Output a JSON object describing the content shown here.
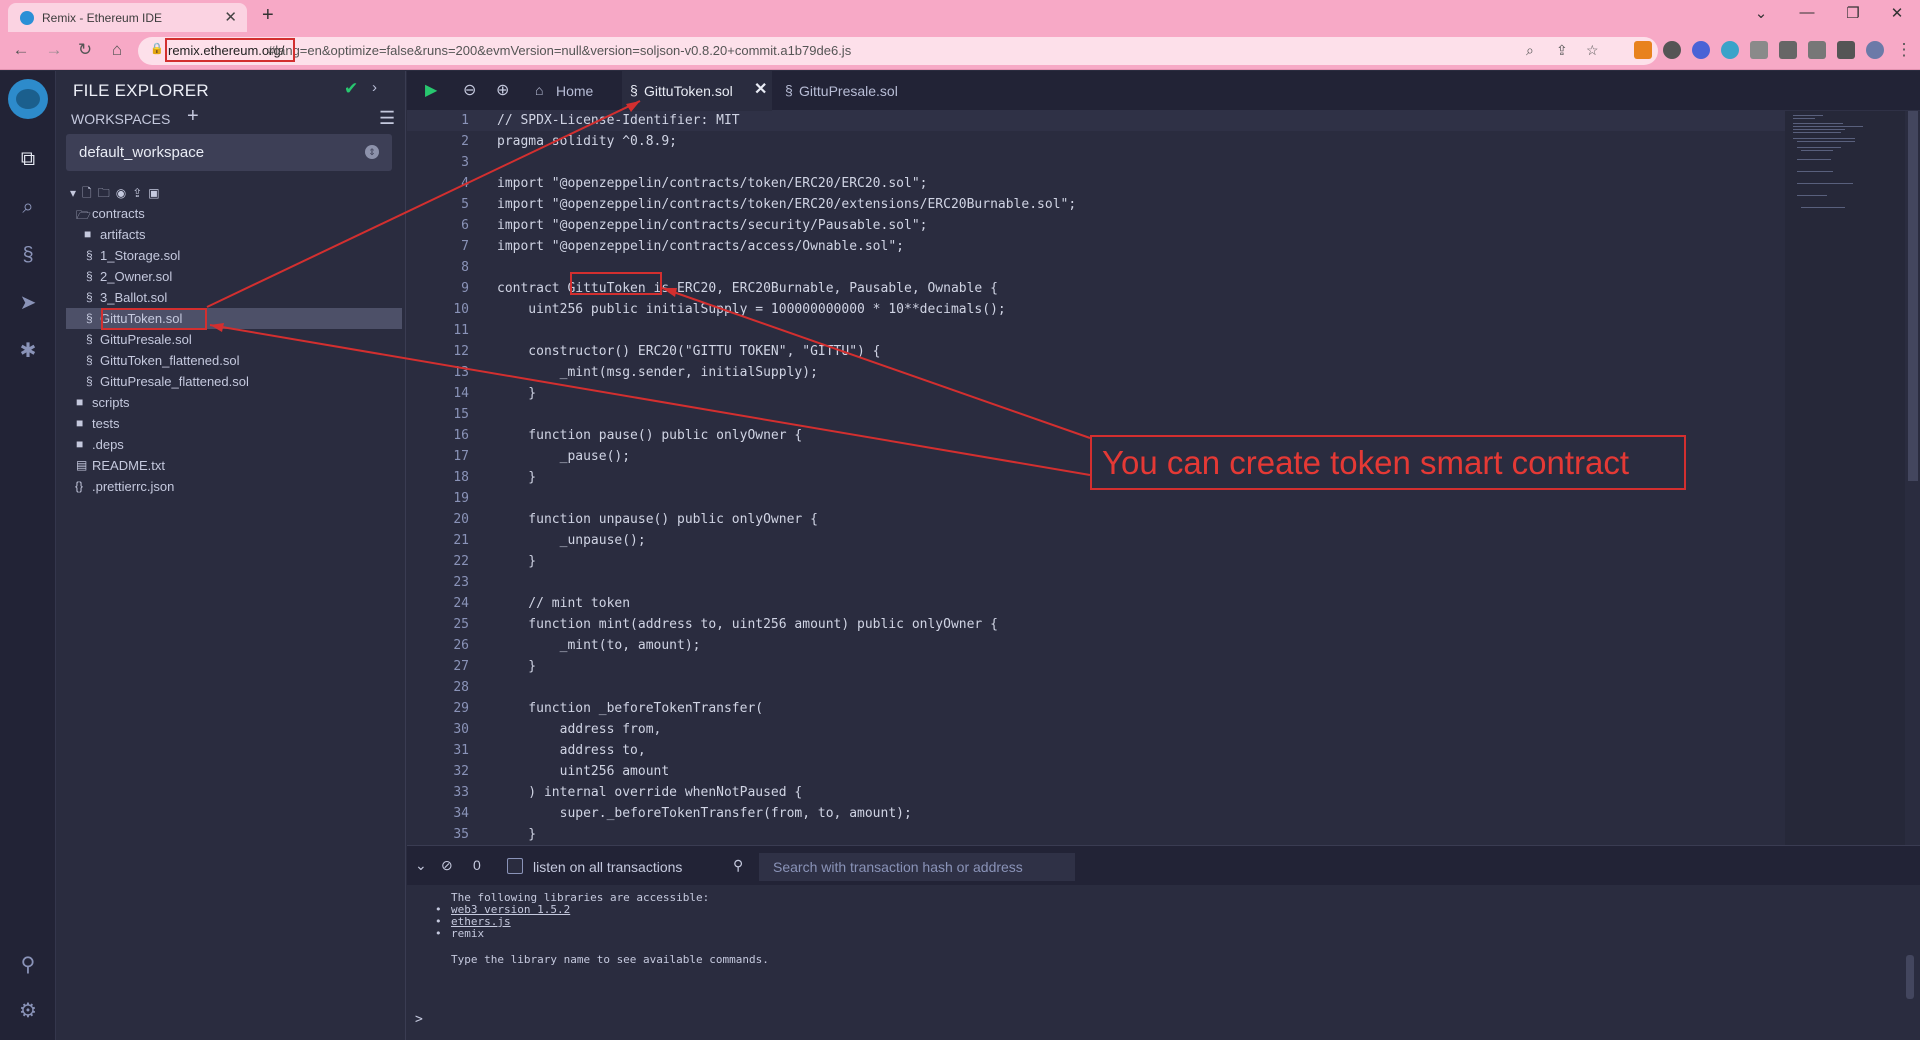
{
  "browser": {
    "tab_title": "Remix - Ethereum IDE",
    "url_host": "remix.ethereum.org/",
    "url_path": "#lang=en&optimize=false&runs=200&evmVersion=null&version=soljson-v0.8.20+commit.a1b79de6.js"
  },
  "sidebar": {
    "title": "FILE EXPLORER",
    "workspaces_label": "WORKSPACES",
    "workspace": "default_workspace",
    "tree": [
      {
        "label": "contracts",
        "type": "folder"
      },
      {
        "label": "artifacts",
        "type": "folder"
      },
      {
        "label": "1_Storage.sol",
        "type": "sol"
      },
      {
        "label": "2_Owner.sol",
        "type": "sol"
      },
      {
        "label": "3_Ballot.sol",
        "type": "sol"
      },
      {
        "label": "GittuToken.sol",
        "type": "sol"
      },
      {
        "label": "GittuPresale.sol",
        "type": "sol"
      },
      {
        "label": "GittuToken_flattened.sol",
        "type": "sol"
      },
      {
        "label": "GittuPresale_flattened.sol",
        "type": "sol"
      },
      {
        "label": "scripts",
        "type": "folder"
      },
      {
        "label": "tests",
        "type": "folder"
      },
      {
        "label": ".deps",
        "type": "folder"
      },
      {
        "label": "README.txt",
        "type": "file"
      },
      {
        "label": ".prettierrc.json",
        "type": "json"
      }
    ]
  },
  "editor": {
    "tabs": [
      {
        "label": "Home"
      },
      {
        "label": "GittuToken.sol",
        "active": true
      },
      {
        "label": "GittuPresale.sol"
      }
    ],
    "lines": [
      "// SPDX-License-Identifier: MIT",
      "pragma solidity ^0.8.9;",
      "",
      "import \"@openzeppelin/contracts/token/ERC20/ERC20.sol\";",
      "import \"@openzeppelin/contracts/token/ERC20/extensions/ERC20Burnable.sol\";",
      "import \"@openzeppelin/contracts/security/Pausable.sol\";",
      "import \"@openzeppelin/contracts/access/Ownable.sol\";",
      "",
      "contract GittuToken is ERC20, ERC20Burnable, Pausable, Ownable {",
      "    uint256 public initialSupply = 100000000000 * 10**decimals();",
      "",
      "    constructor() ERC20(\"GITTU TOKEN\", \"GITTU\") {",
      "        _mint(msg.sender, initialSupply);",
      "    }",
      "",
      "    function pause() public onlyOwner {",
      "        _pause();",
      "    }",
      "",
      "    function unpause() public onlyOwner {",
      "        _unpause();",
      "    }",
      "",
      "    // mint token",
      "    function mint(address to, uint256 amount) public onlyOwner {",
      "        _mint(to, amount);",
      "    }",
      "",
      "    function _beforeTokenTransfer(",
      "        address from,",
      "        address to,",
      "        uint256 amount",
      "    ) internal override whenNotPaused {",
      "        super._beforeTokenTransfer(from, to, amount);",
      "    }"
    ]
  },
  "terminal": {
    "count": "0",
    "listen_label": "listen on all transactions",
    "search_placeholder": "Search with transaction hash or address",
    "intro": "The following libraries are accessible:",
    "libs": [
      "web3 version 1.5.2",
      "ethers.js",
      "remix"
    ],
    "hint": "Type the library name to see available commands.",
    "prompt": ">"
  },
  "annotation": {
    "text": "You can create token smart contract",
    "color": "#d32f2f"
  },
  "colors": {
    "browser_chrome": "#f7a9c6",
    "panel_bg": "#2a2c3f",
    "icon_panel_bg": "#222336",
    "success": "#28c76f"
  }
}
